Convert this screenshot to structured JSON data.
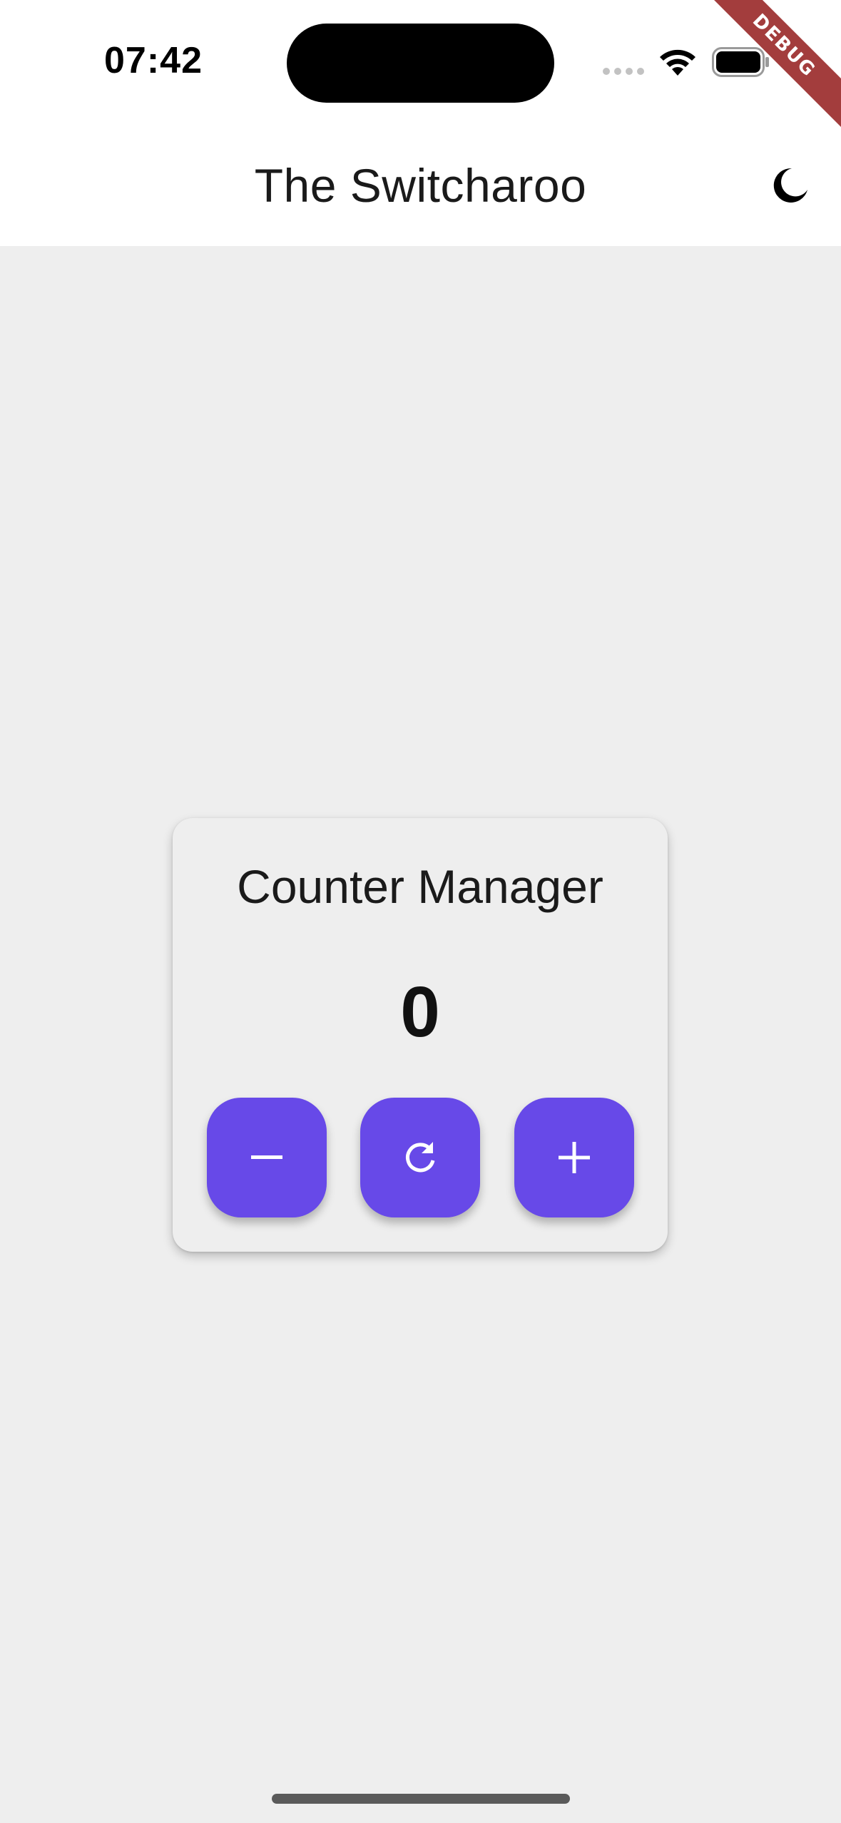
{
  "status_bar": {
    "time": "07:42"
  },
  "app_bar": {
    "title": "The Switcharoo",
    "theme_toggle_icon": "moon-icon"
  },
  "debug_banner": {
    "label": "DEBUG"
  },
  "counter_card": {
    "title": "Counter Manager",
    "value": "0",
    "buttons": [
      {
        "icon": "minus-icon",
        "action": "decrement"
      },
      {
        "icon": "refresh-icon",
        "action": "reset"
      },
      {
        "icon": "plus-icon",
        "action": "increment"
      }
    ]
  },
  "colors": {
    "accent": "#6749e8",
    "background": "#eeeeee",
    "app_bar": "#ffffff",
    "debug_ribbon": "#a33d3d"
  }
}
